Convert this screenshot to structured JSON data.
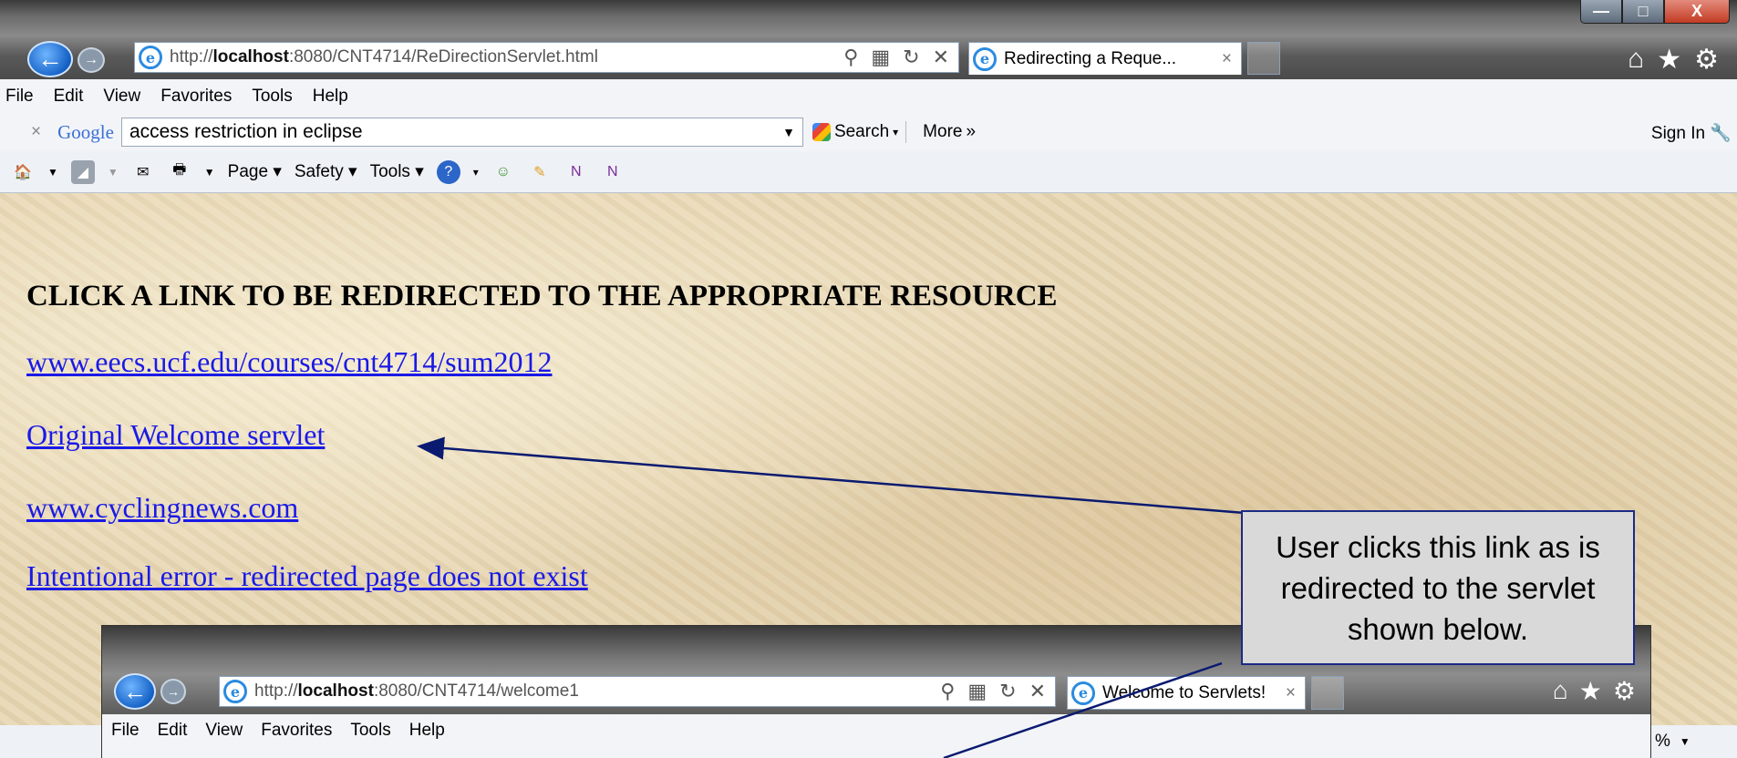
{
  "browser": {
    "address_url_prefix": "http://",
    "address_url_host": "localhost",
    "address_url_rest": ":8080/CNT4714/ReDirectionServlet.html",
    "tab_title": "Redirecting a Reque...",
    "tab_close": "×",
    "window_min": "—",
    "window_max": "□",
    "window_close": "X",
    "menu": [
      "File",
      "Edit",
      "View",
      "Favorites",
      "Tools",
      "Help"
    ],
    "google_toolbar": {
      "close": "×",
      "logo": "Google",
      "search_value": "access restriction in eclipse",
      "search_button": "Search",
      "more_button": "More",
      "sign_in": "Sign In"
    },
    "command_bar": {
      "page_label": "Page",
      "safety_label": "Safety",
      "tools_label": "Tools"
    }
  },
  "page": {
    "heading": "CLICK A LINK TO BE REDIRECTED TO THE APPROPRIATE RESOURCE",
    "links": [
      "www.eecs.ucf.edu/courses/cnt4714/sum2012",
      "Original Welcome servlet",
      "www.cyclingnews.com",
      "Intentional error - redirected page does not exist"
    ]
  },
  "annotation": {
    "callout_text": "User clicks this link as is redirected to the servlet shown below."
  },
  "nested_browser": {
    "address_url_prefix": "http://",
    "address_url_host": "localhost",
    "address_url_rest": ":8080/CNT4714/welcome1",
    "tab_title": "Welcome to Servlets!",
    "tab_close": "×",
    "menu": [
      "File",
      "Edit",
      "View",
      "Favorites",
      "Tools",
      "Help"
    ]
  },
  "status": {
    "zoom_fragment": "%"
  }
}
